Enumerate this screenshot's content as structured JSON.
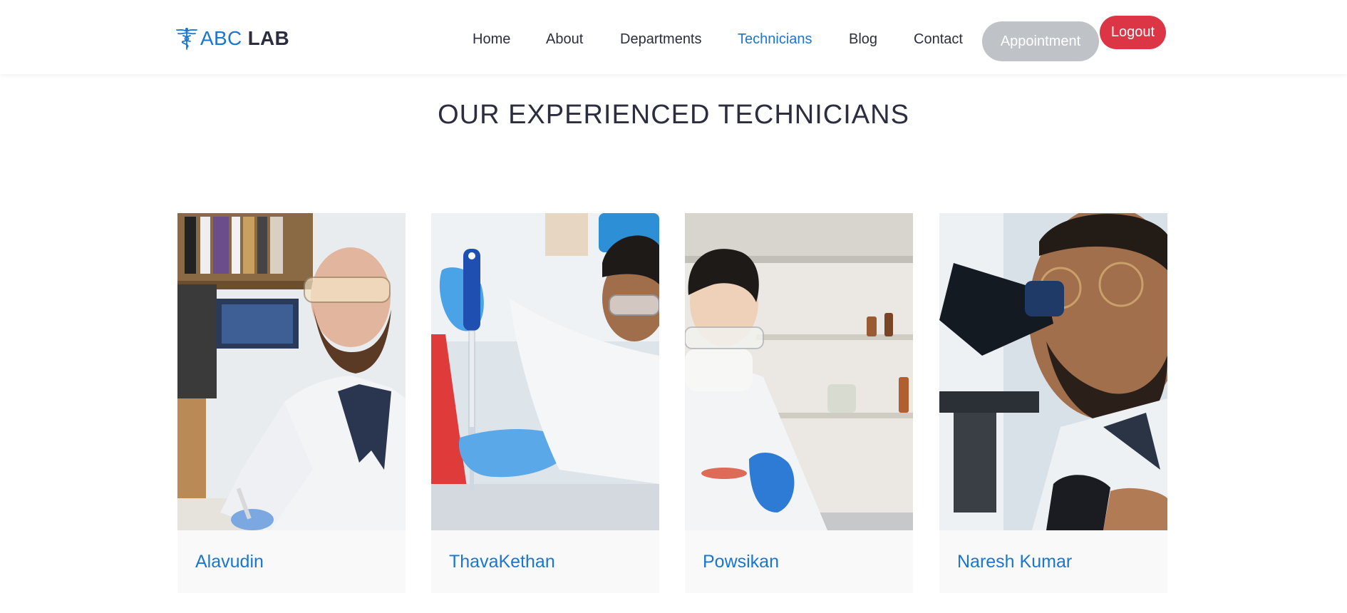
{
  "header": {
    "logo": {
      "brand_light": "ABC",
      "brand_bold": "LAB",
      "icon": "caduceus-icon"
    },
    "nav": [
      {
        "label": "Home",
        "active": false
      },
      {
        "label": "About",
        "active": false
      },
      {
        "label": "Departments",
        "active": false
      },
      {
        "label": "Technicians",
        "active": true
      },
      {
        "label": "Blog",
        "active": false
      },
      {
        "label": "Contact",
        "active": false
      }
    ],
    "appointment_label": "Appointment",
    "logout_label": "Logout"
  },
  "section": {
    "title": "OUR EXPERIENCED TECHNICIANS"
  },
  "technicians": [
    {
      "name": "Alavudin",
      "photo": "lab-technician-with-goggles-photo"
    },
    {
      "name": "ThavaKethan",
      "photo": "technician-with-pipette-photo"
    },
    {
      "name": "Powsikan",
      "photo": "technician-with-petri-dish-photo"
    },
    {
      "name": "Naresh Kumar",
      "photo": "technician-at-microscope-photo"
    }
  ],
  "colors": {
    "accent": "#1a76d1",
    "text": "#2c2d3f",
    "appointment_bg": "#bfc3c8",
    "logout_bg": "#dc3545"
  }
}
